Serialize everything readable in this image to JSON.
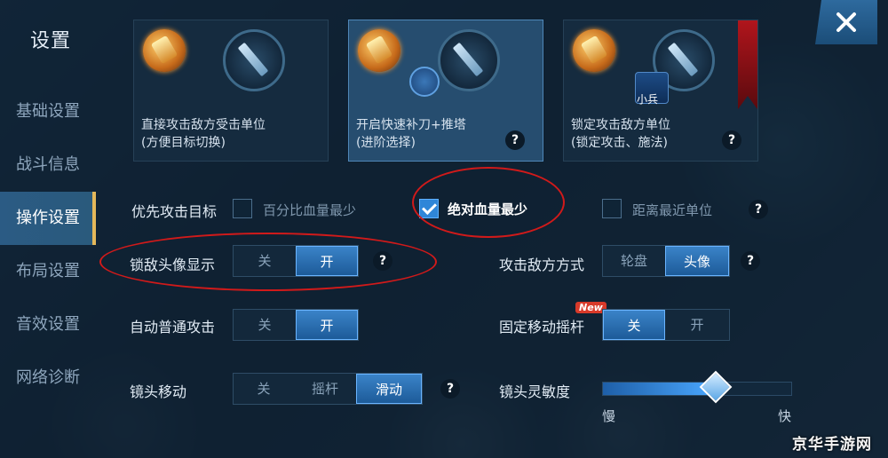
{
  "title": "设置",
  "sidebar": {
    "items": [
      {
        "label": "基础设置"
      },
      {
        "label": "战斗信息"
      },
      {
        "label": "操作设置"
      },
      {
        "label": "布局设置"
      },
      {
        "label": "音效设置"
      },
      {
        "label": "网络诊断"
      }
    ],
    "active_index": 2
  },
  "close_icon": "close-icon",
  "attack_modes": [
    {
      "line1": "直接攻击敌方受击单位",
      "line2": "(方便目标切换)",
      "help": false,
      "selected": false
    },
    {
      "line1": "开启快速补刀+推塔",
      "line2": "(进阶选择)",
      "help": true,
      "selected": true
    },
    {
      "line1": "锁定攻击敌方单位",
      "line2": "(锁定攻击、施法)",
      "help": true,
      "selected": false,
      "minion_label": "小兵"
    }
  ],
  "priority_target": {
    "label": "优先攻击目标",
    "options": [
      {
        "label": "百分比血量最少",
        "checked": false
      },
      {
        "label": "绝对血量最少",
        "checked": true
      },
      {
        "label": "距离最近单位",
        "checked": false
      }
    ]
  },
  "lock_avatar": {
    "label": "锁敌头像显示",
    "options": [
      "关",
      "开"
    ],
    "selected": "开"
  },
  "attack_method": {
    "label": "攻击敌方方式",
    "options": [
      "轮盘",
      "头像"
    ],
    "selected": "头像"
  },
  "auto_attack": {
    "label": "自动普通攻击",
    "options": [
      "关",
      "开"
    ],
    "selected": "开"
  },
  "fixed_joystick": {
    "label": "固定移动摇杆",
    "badge": "New",
    "options": [
      "关",
      "开"
    ],
    "selected": "关"
  },
  "camera_move": {
    "label": "镜头移动",
    "options": [
      "关",
      "摇杆",
      "滑动"
    ],
    "selected": "滑动"
  },
  "camera_sensitivity": {
    "label": "镜头灵敏度",
    "min_label": "慢",
    "max_label": "快",
    "value": 0.6
  },
  "help_symbol": "?",
  "watermark": "京华手游网",
  "colors": {
    "accent": "#2f86d8",
    "active_tab_border": "#e4b85a",
    "annotation_red": "#d11a1a"
  }
}
